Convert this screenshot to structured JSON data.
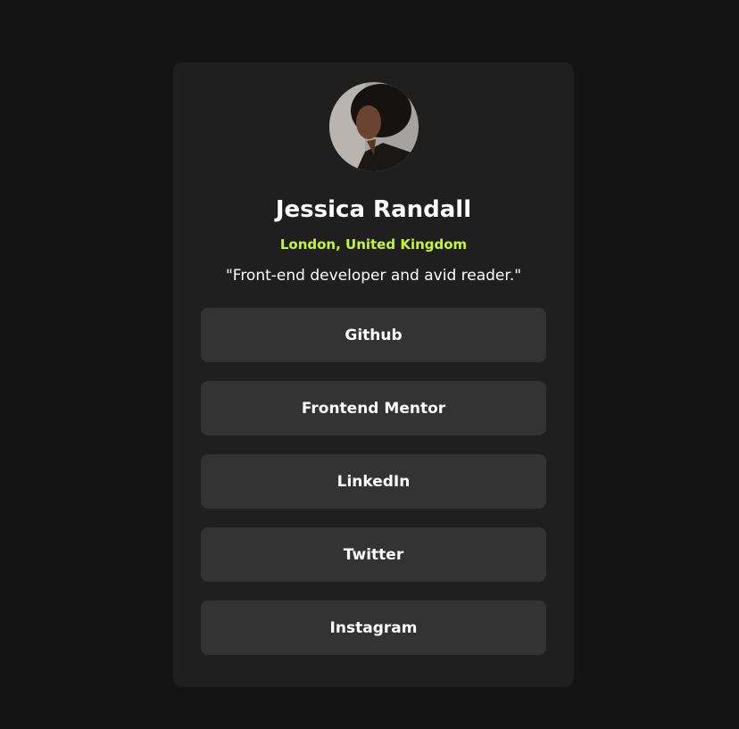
{
  "profile": {
    "name": "Jessica Randall",
    "location": "London, United Kingdom",
    "bio": "\"Front-end developer and avid reader.\""
  },
  "links": [
    {
      "label": "Github"
    },
    {
      "label": "Frontend Mentor"
    },
    {
      "label": "LinkedIn"
    },
    {
      "label": "Twitter"
    },
    {
      "label": "Instagram"
    }
  ],
  "colors": {
    "background": "#141414",
    "card": "#1f1f1f",
    "button": "#333333",
    "accent": "#c4f82a"
  }
}
